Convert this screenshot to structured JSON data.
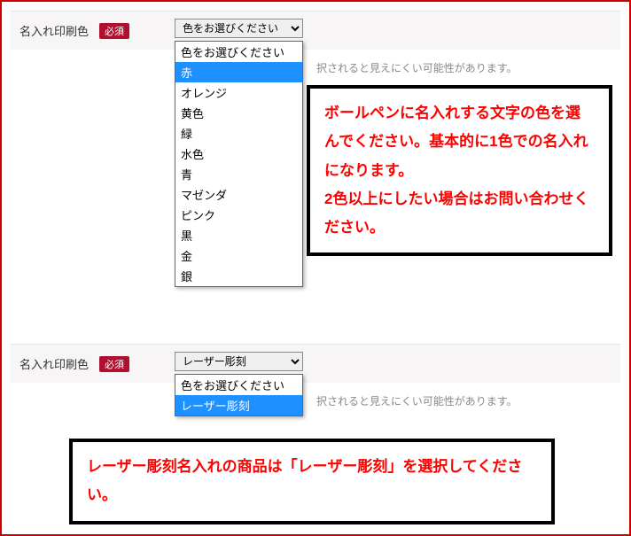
{
  "section1": {
    "label": "名入れ印刷色",
    "required_badge": "必須",
    "select_value": "色をお選びください",
    "hint_partial": "択されると見えにくい可能性があります。",
    "dropdown": {
      "items": [
        {
          "label": "色をお選びください",
          "hl": false
        },
        {
          "label": "赤",
          "hl": true
        },
        {
          "label": "オレンジ",
          "hl": false
        },
        {
          "label": "黄色",
          "hl": false
        },
        {
          "label": "緑",
          "hl": false
        },
        {
          "label": "水色",
          "hl": false
        },
        {
          "label": "青",
          "hl": false
        },
        {
          "label": "マゼンダ",
          "hl": false
        },
        {
          "label": "ピンク",
          "hl": false
        },
        {
          "label": "黒",
          "hl": false
        },
        {
          "label": "金",
          "hl": false
        },
        {
          "label": "銀",
          "hl": false
        }
      ]
    },
    "callout": "ボールペンに名入れする文字の色を選んでください。基本的に1色での名入れになります。\n2色以上にしたい場合はお問い合わせください。"
  },
  "section2": {
    "label": "名入れ印刷色",
    "required_badge": "必須",
    "select_value": "レーザー彫刻",
    "hint_partial": "択されると見えにくい可能性があります。",
    "dropdown": {
      "items": [
        {
          "label": "色をお選びください",
          "hl": false
        },
        {
          "label": "レーザー彫刻",
          "hl": true
        }
      ]
    },
    "callout": "レーザー彫刻名入れの商品は「レーザー彫刻」を選択してください。"
  }
}
